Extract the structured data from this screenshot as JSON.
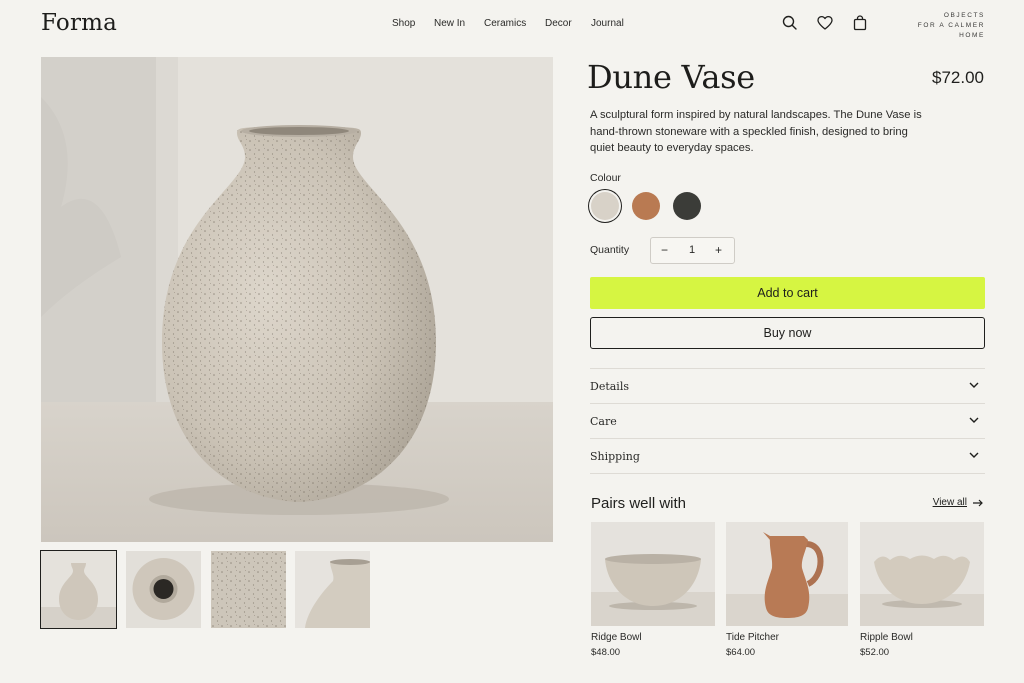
{
  "brand": {
    "logo": "Forma",
    "tagline": [
      "OBJECTS",
      "FOR A CALMER",
      "HOME"
    ]
  },
  "nav": [
    "Shop",
    "New In",
    "Ceramics",
    "Decor",
    "Journal"
  ],
  "header_icons": [
    "search-icon",
    "heart-icon",
    "bag-icon"
  ],
  "product": {
    "title": "Dune Vase",
    "price": "$72.00",
    "description": "A sculptural form inspired by natural landscapes. The Dune Vase is hand-thrown stoneware with a speckled finish, designed to bring quiet beauty to everyday spaces.",
    "colour_label": "Colour",
    "colours": [
      {
        "hex": "#d8d2c8",
        "selected": true
      },
      {
        "hex": "#b97a52",
        "selected": false
      },
      {
        "hex": "#3b3c38",
        "selected": false
      }
    ],
    "quantity_label": "Quantity",
    "quantity": "1",
    "add_to_cart": "Add to cart",
    "buy_now": "Buy now"
  },
  "accordion": [
    "Details",
    "Care",
    "Shipping"
  ],
  "pairs": {
    "title": "Pairs well with",
    "view_all": "View all",
    "items": [
      {
        "name": "Ridge Bowl",
        "price": "$48.00"
      },
      {
        "name": "Tide Pitcher",
        "price": "$64.00"
      },
      {
        "name": "Ripple Bowl",
        "price": "$52.00"
      }
    ]
  },
  "colors": {
    "accent": "#d6f542",
    "background": "#f4f3ef",
    "text": "#1f1f1d"
  }
}
